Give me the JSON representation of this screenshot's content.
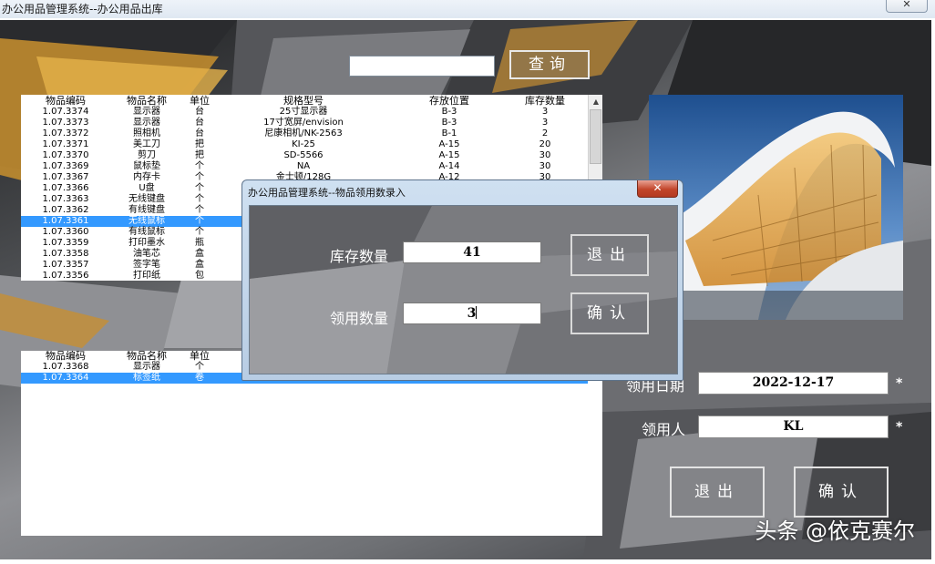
{
  "window": {
    "title": "办公用品管理系统--办公用品出库",
    "close_symbol": "✕"
  },
  "search": {
    "input_value": "",
    "button_label": "查询"
  },
  "stock_table": {
    "columns": [
      "物品编码",
      "物品名称",
      "单位",
      "规格型号",
      "存放位置",
      "库存数量"
    ],
    "rows": [
      [
        "1.07.3374",
        "显示器",
        "台",
        "25寸显示器",
        "B-3",
        "3"
      ],
      [
        "1.07.3373",
        "显示器",
        "台",
        "17寸宽屏/envision",
        "B-3",
        "3"
      ],
      [
        "1.07.3372",
        "照相机",
        "台",
        "尼康相机/NK-2563",
        "B-1",
        "2"
      ],
      [
        "1.07.3371",
        "美工刀",
        "把",
        "KI-25",
        "A-15",
        "20"
      ],
      [
        "1.07.3370",
        "剪刀",
        "把",
        "SD-5566",
        "A-15",
        "30"
      ],
      [
        "1.07.3369",
        "鼠标垫",
        "个",
        "NA",
        "A-14",
        "30"
      ],
      [
        "1.07.3367",
        "内存卡",
        "个",
        "金士顿/128G",
        "A-12",
        "30"
      ],
      [
        "1.07.3366",
        "U盘",
        "个",
        "",
        "",
        ""
      ],
      [
        "1.07.3363",
        "无线键盘",
        "个",
        "",
        "",
        ""
      ],
      [
        "1.07.3362",
        "有线键盘",
        "个",
        "",
        "",
        ""
      ],
      [
        "1.07.3361",
        "无线鼠标",
        "个",
        "",
        "",
        ""
      ],
      [
        "1.07.3360",
        "有线鼠标",
        "个",
        "",
        "",
        ""
      ],
      [
        "1.07.3359",
        "打印墨水",
        "瓶",
        "",
        "",
        ""
      ],
      [
        "1.07.3358",
        "油笔芯",
        "盒",
        "",
        "",
        ""
      ],
      [
        "1.07.3357",
        "签字笔",
        "盒",
        "",
        "",
        ""
      ],
      [
        "1.07.3356",
        "打印纸",
        "包",
        "",
        "",
        ""
      ]
    ],
    "selected_row": 10
  },
  "issue_table": {
    "columns": [
      "物品编码",
      "物品名称",
      "单位"
    ],
    "rows": [
      [
        "1.07.3368",
        "显示器",
        "个"
      ],
      [
        "1.07.3364",
        "标签纸",
        "卷"
      ]
    ],
    "selected_row": 1
  },
  "form": {
    "date_label": "领用日期",
    "date_value": "2022-12-17",
    "person_label": "领用人",
    "person_value": "KL",
    "required_mark": "*",
    "exit_label": "退出",
    "confirm_label": "确认"
  },
  "dialog": {
    "title": "办公用品管理系统--物品领用数录入",
    "close_symbol": "✕",
    "stock_label": "库存数量",
    "stock_value": "41",
    "issue_label": "领用数量",
    "issue_value": "3",
    "exit_label": "退出",
    "confirm_label": "确认"
  },
  "watermark": "头条 @依克赛尔",
  "colors": {
    "selection": "#3399ff",
    "dialog_frame": "#b8cde4",
    "dialog_close": "#c2452a"
  }
}
